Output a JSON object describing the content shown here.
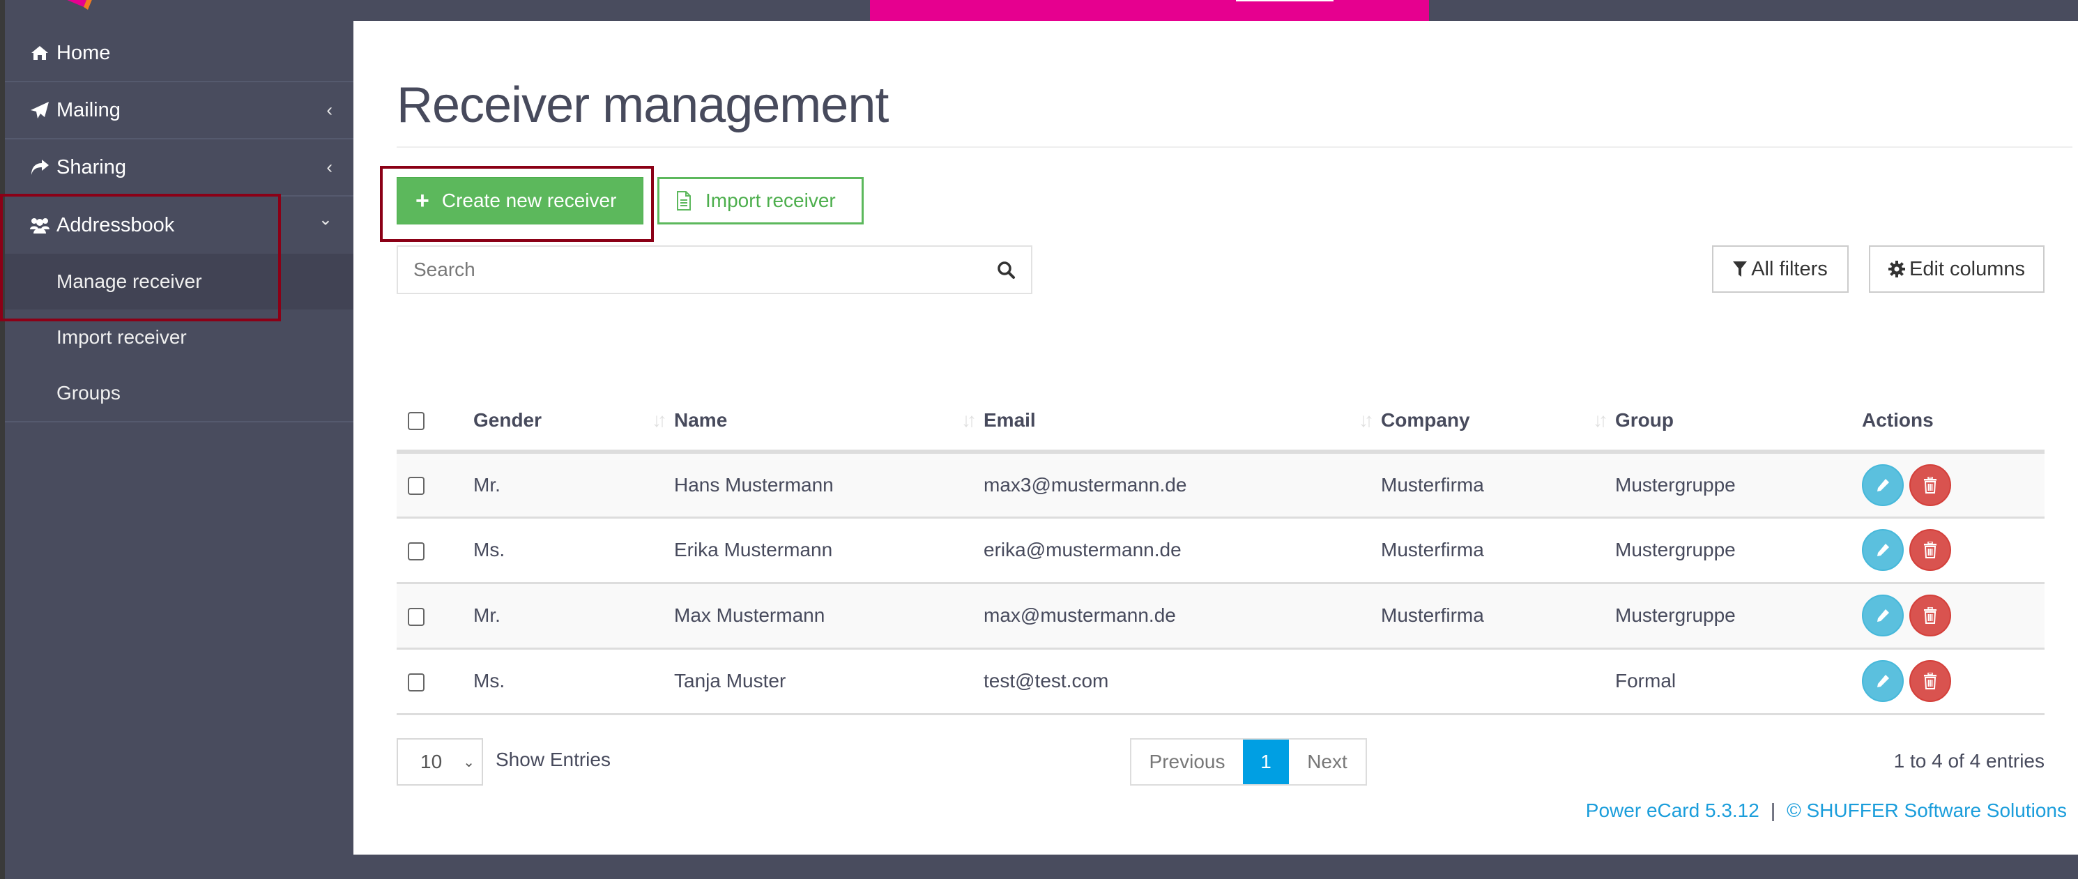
{
  "brand": {
    "colors": {
      "sidebar": "#494c5e",
      "accent_pink": "#e6008f",
      "success": "#5cb85c",
      "info": "#5bc0de",
      "danger": "#d9534f",
      "primary_page": "#009fe3",
      "highlight_box": "#8b0016"
    }
  },
  "sidebar": {
    "items": [
      {
        "label": "Home",
        "icon": "home-icon"
      },
      {
        "label": "Mailing",
        "icon": "paper-plane-icon",
        "chevron": "‹"
      },
      {
        "label": "Sharing",
        "icon": "share-icon",
        "chevron": "‹"
      },
      {
        "label": "Addressbook",
        "icon": "users-icon",
        "chevron": "⌄"
      }
    ],
    "subitems": [
      {
        "label": "Manage receiver",
        "active": true
      },
      {
        "label": "Import receiver"
      },
      {
        "label": "Groups"
      }
    ]
  },
  "main": {
    "title": "Receiver management",
    "create_button": "Create new receiver",
    "import_button": "Import receiver",
    "search": {
      "placeholder": "Search",
      "value": ""
    },
    "all_filters_button": "All filters",
    "edit_columns_button": "Edit columns"
  },
  "table": {
    "columns": [
      "Gender",
      "Name",
      "Email",
      "Company",
      "Group",
      "Actions"
    ],
    "rows": [
      {
        "gender": "Mr.",
        "name": "Hans Mustermann",
        "email": "max3@mustermann.de",
        "company": "Musterfirma",
        "group": "Mustergruppe"
      },
      {
        "gender": "Ms.",
        "name": "Erika Mustermann",
        "email": "erika@mustermann.de",
        "company": "Musterfirma",
        "group": "Mustergruppe"
      },
      {
        "gender": "Mr.",
        "name": "Max Mustermann",
        "email": "max@mustermann.de",
        "company": "Musterfirma",
        "group": "Mustergruppe"
      },
      {
        "gender": "Ms.",
        "name": "Tanja Muster",
        "email": "test@test.com",
        "company": "",
        "group": "Formal"
      }
    ]
  },
  "pagination": {
    "page_length": "10",
    "page_length_label": "Show Entries",
    "previous": "Previous",
    "current_page": "1",
    "next": "Next",
    "info": "1 to 4 of 4 entries"
  },
  "footer": {
    "product": "Power eCard 5.3.12",
    "separator": "|",
    "copyright": "© SHUFFER Software Solutions"
  }
}
